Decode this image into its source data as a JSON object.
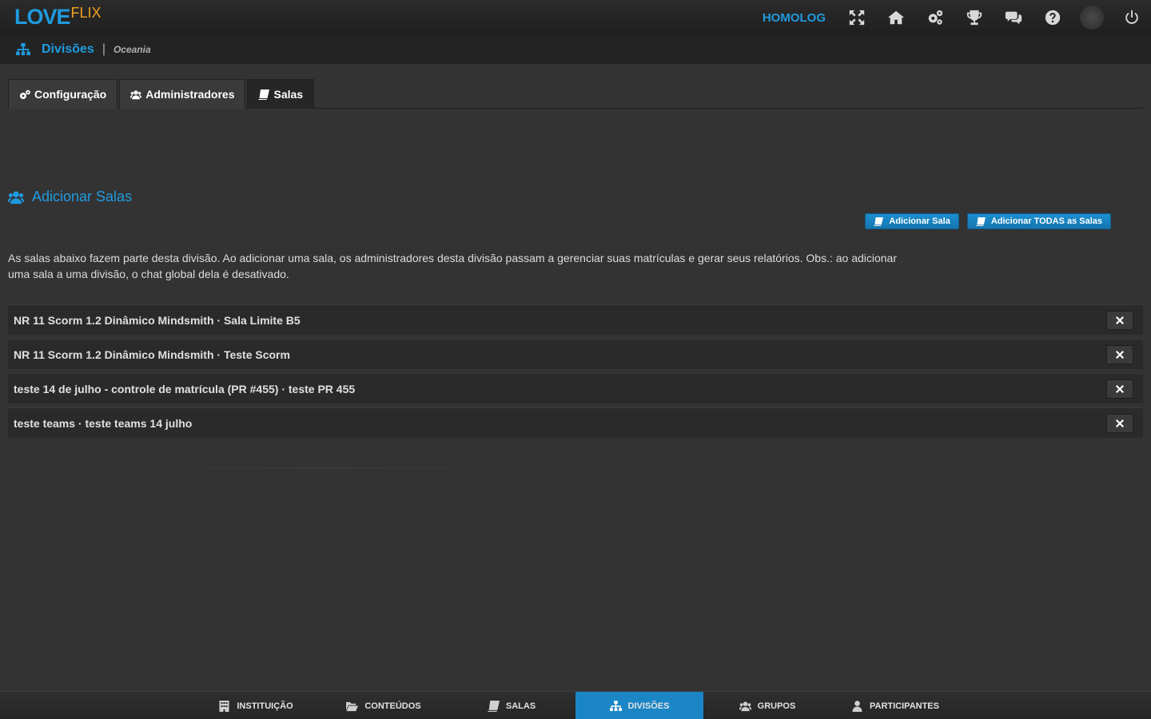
{
  "header": {
    "logo_primary": "LOVE",
    "logo_secondary": "FLIX",
    "environment": "HOMOLOG",
    "icons": [
      "fullscreen-icon",
      "home-icon",
      "settings-icon",
      "trophy-icon",
      "chat-icon",
      "help-icon",
      "avatar",
      "power-icon"
    ]
  },
  "subheader": {
    "title": "Divisões",
    "separator": "|",
    "crumb": "Oceania"
  },
  "tabs": [
    {
      "label": "Configuração",
      "icon": "gears-icon",
      "active": false
    },
    {
      "label": "Administradores",
      "icon": "users-icon",
      "active": false
    },
    {
      "label": "Salas",
      "icon": "book-icon",
      "active": true
    }
  ],
  "section": {
    "title": "Adicionar Salas",
    "add_room_label": "Adicionar Sala",
    "add_all_label": "Adicionar TODAS as Salas",
    "description": "As salas abaixo fazem parte desta divisão. Ao adicionar uma sala, os administradores desta divisão passam a gerenciar suas matrículas e gerar seus relatórios. Obs.: ao adicionar uma sala a uma divisão, o chat global dela é desativado."
  },
  "rooms": [
    {
      "name": "NR 11 Scorm 1.2 Dinâmico Mindsmith · Sala Limite B5"
    },
    {
      "name": "NR 11 Scorm 1.2 Dinâmico Mindsmith · Teste Scorm"
    },
    {
      "name": "teste 14 de julho - controle de matrícula (PR #455) · teste PR 455"
    },
    {
      "name": "teste teams · teste teams 14 julho"
    }
  ],
  "bottom_nav": [
    {
      "label": "INSTITUIÇÃO",
      "icon": "building-icon",
      "active": false
    },
    {
      "label": "CONTEÚDOS",
      "icon": "folder-icon",
      "active": false
    },
    {
      "label": "SALAS",
      "icon": "book-icon",
      "active": false
    },
    {
      "label": "DIVISÕES",
      "icon": "sitemap-icon",
      "active": true
    },
    {
      "label": "GRUPOS",
      "icon": "users-icon",
      "active": false
    },
    {
      "label": "PARTICIPANTES",
      "icon": "user-icon",
      "active": false
    }
  ],
  "colors": {
    "accent": "#1f9be0",
    "logo_secondary": "#f0a020",
    "background": "#333333",
    "active_nav": "#1a86c6"
  }
}
